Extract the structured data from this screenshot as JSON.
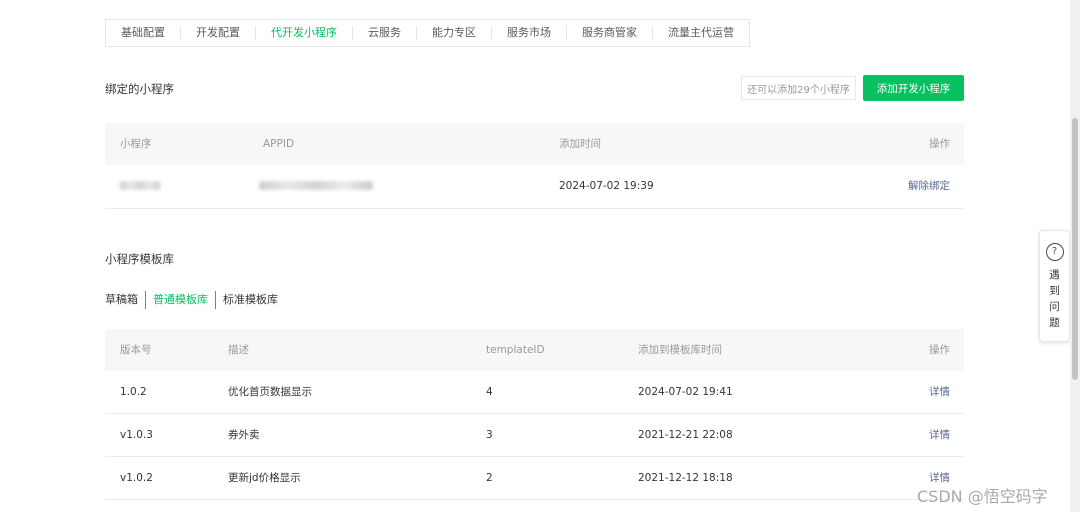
{
  "nav": {
    "tabs": [
      "基础配置",
      "开发配置",
      "代开发小程序",
      "云服务",
      "能力专区",
      "服务市场",
      "服务商管家",
      "流量主代运营"
    ],
    "active_index": 2
  },
  "bound": {
    "title": "绑定的小程序",
    "quota_text": "还可以添加29个小程序",
    "add_button": "添加开发小程序",
    "columns": [
      "小程序",
      "APPID",
      "添加时间",
      "操作"
    ],
    "rows": [
      {
        "time": "2024-07-02 19:39",
        "action": "解除绑定"
      }
    ]
  },
  "templates": {
    "title": "小程序模板库",
    "tabs": [
      "草稿箱",
      "普通模板库",
      "标准模板库"
    ],
    "active_tab": 1,
    "columns": [
      "版本号",
      "描述",
      "templateID",
      "添加到模板库时间",
      "操作"
    ],
    "rows": [
      {
        "version": "1.0.2",
        "desc": "优化首页数据显示",
        "id": "4",
        "time": "2024-07-02 19:41",
        "action": "详情"
      },
      {
        "version": "v1.0.3",
        "desc": "券外卖",
        "id": "3",
        "time": "2021-12-21 22:08",
        "action": "详情"
      },
      {
        "version": "v1.0.2",
        "desc": "更新jd价格显示",
        "id": "2",
        "time": "2021-12-12 18:18",
        "action": "详情"
      }
    ]
  },
  "help": {
    "label": "遇到问题",
    "icon": "question-icon"
  },
  "watermark": "CSDN @悟空码字",
  "colors": {
    "accent": "#07c160",
    "link": "#576b95"
  }
}
